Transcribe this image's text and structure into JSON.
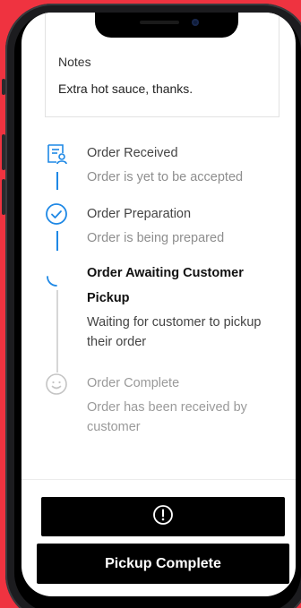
{
  "notes": {
    "label": "Notes",
    "text": "Extra hot sauce, thanks."
  },
  "order_status": {
    "steps": [
      {
        "title": "Order Received",
        "subtitle": "Order is yet to be accepted",
        "state": "done",
        "icon": "receipt-icon"
      },
      {
        "title": "Order Preparation",
        "subtitle": "Order is being prepared",
        "state": "done",
        "icon": "check-circle-icon"
      },
      {
        "title": "Order Awaiting Customer Pickup",
        "subtitle": "Waiting for customer to pickup their order",
        "state": "active",
        "icon": "spinner-icon"
      },
      {
        "title": "Order Complete",
        "subtitle": "Order has been received by customer",
        "state": "pending",
        "icon": "smiley-icon"
      }
    ]
  },
  "actions": {
    "alert_icon": "exclamation-circle-icon",
    "pickup_label": "Pickup Complete"
  },
  "colors": {
    "background": "#ef3340",
    "accent": "#1e88e5",
    "button": "#000000"
  }
}
